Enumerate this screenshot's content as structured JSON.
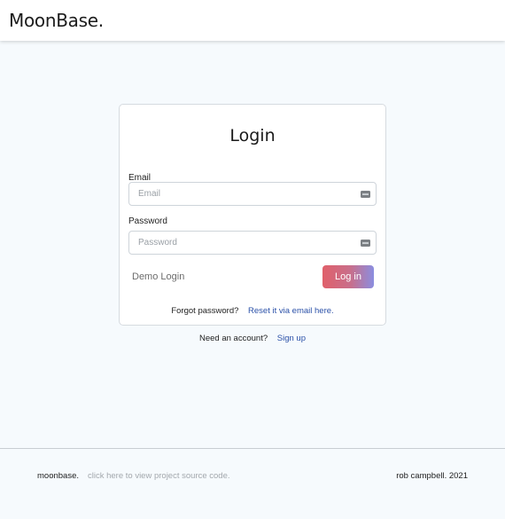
{
  "navbar": {
    "brand": "MoonBase."
  },
  "login": {
    "title": "Login",
    "email_label": "Email",
    "email_placeholder": "Email",
    "email_value": "",
    "password_label": "Password",
    "password_placeholder": "Password",
    "password_value": "",
    "demo_login_label": "Demo Login",
    "login_button_label": "Log in",
    "forgot_text": "Forgot password?",
    "reset_link": "Reset it via email here."
  },
  "signup": {
    "text": "Need an account?",
    "link": "Sign up"
  },
  "footer": {
    "brand": "moonbase.",
    "source_link": "click here to view project source code.",
    "credit": "rob campbell. 2021"
  },
  "colors": {
    "background": "#f6fafd",
    "link": "#2a50a8",
    "login_gradient": [
      "#e0606a",
      "#8b8ee0"
    ]
  },
  "icons": {
    "field_icon": "credentials-icon"
  }
}
